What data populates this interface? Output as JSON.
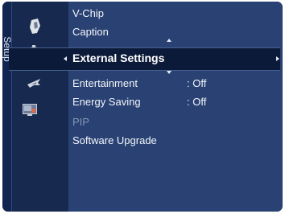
{
  "menu": {
    "tab_label": "Setup",
    "items_above": [
      {
        "label": "V-Chip"
      },
      {
        "label": "Caption"
      }
    ],
    "selected": {
      "label": "External Settings"
    },
    "items_below": [
      {
        "label": "Entertainment",
        "value": ": Off",
        "disabled": false
      },
      {
        "label": "Energy Saving",
        "value": ": Off",
        "disabled": false
      },
      {
        "label": "PIP",
        "value": "",
        "disabled": true
      },
      {
        "label": "Software Upgrade",
        "value": "",
        "disabled": false
      }
    ]
  },
  "icons": [
    "v-chip-icon",
    "setup-gear-icon",
    "antenna-icon",
    "pip-icon"
  ],
  "colors": {
    "panel_bg": "#2a4273",
    "selected_bg": "#0c1a3a",
    "text": "#f2f5fb",
    "disabled_text": "#8595b3"
  }
}
